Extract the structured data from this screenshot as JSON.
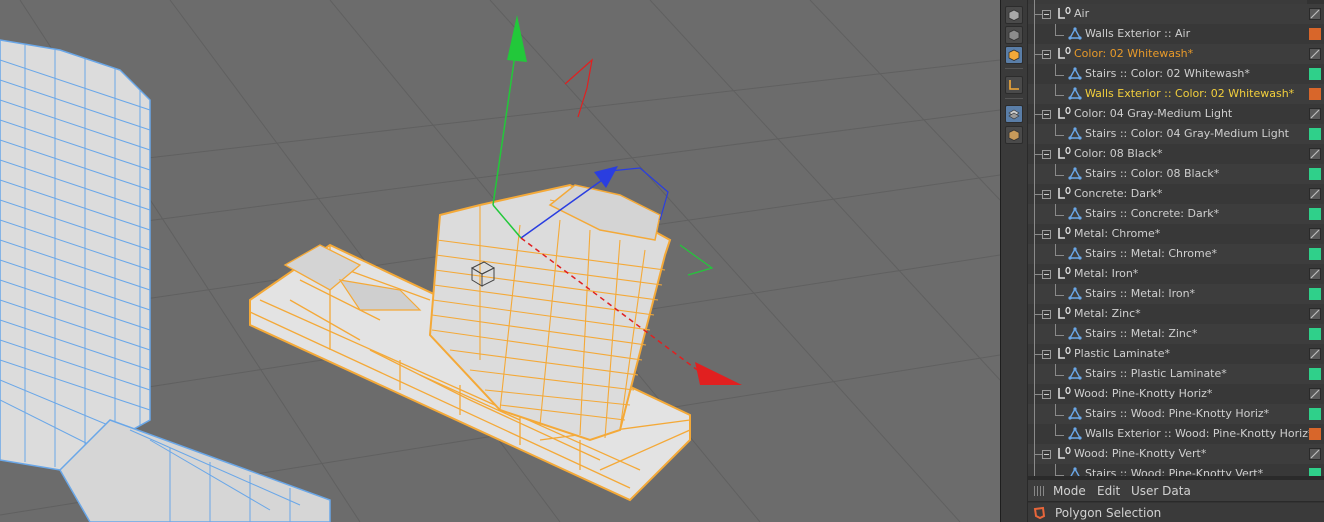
{
  "object_manager": {
    "rows": [
      {
        "label": "Air",
        "level": 0,
        "color": "normal",
        "tag": "slash"
      },
      {
        "label": "Walls Exterior :: Air",
        "level": 1,
        "color": "normal",
        "tag": "orange"
      },
      {
        "label": "Color: 02 Whitewash*",
        "level": 0,
        "color": "orange",
        "tag": "slash"
      },
      {
        "label": "Stairs :: Color: 02 Whitewash*",
        "level": 1,
        "color": "normal",
        "tag": "green"
      },
      {
        "label": "Walls Exterior :: Color: 02 Whitewash*",
        "level": 1,
        "color": "yellow",
        "tag": "orange"
      },
      {
        "label": "Color: 04 Gray-Medium Light",
        "level": 0,
        "color": "normal",
        "tag": "slash"
      },
      {
        "label": "Stairs :: Color: 04 Gray-Medium Light",
        "level": 1,
        "color": "normal",
        "tag": "green"
      },
      {
        "label": "Color: 08 Black*",
        "level": 0,
        "color": "normal",
        "tag": "slash"
      },
      {
        "label": "Stairs :: Color: 08 Black*",
        "level": 1,
        "color": "normal",
        "tag": "green"
      },
      {
        "label": "Concrete: Dark*",
        "level": 0,
        "color": "normal",
        "tag": "slash"
      },
      {
        "label": "Stairs :: Concrete: Dark*",
        "level": 1,
        "color": "normal",
        "tag": "green"
      },
      {
        "label": "Metal: Chrome*",
        "level": 0,
        "color": "normal",
        "tag": "slash"
      },
      {
        "label": "Stairs :: Metal: Chrome*",
        "level": 1,
        "color": "normal",
        "tag": "green"
      },
      {
        "label": "Metal: Iron*",
        "level": 0,
        "color": "normal",
        "tag": "slash"
      },
      {
        "label": "Stairs :: Metal: Iron*",
        "level": 1,
        "color": "normal",
        "tag": "green"
      },
      {
        "label": "Metal: Zinc*",
        "level": 0,
        "color": "normal",
        "tag": "slash"
      },
      {
        "label": "Stairs :: Metal: Zinc*",
        "level": 1,
        "color": "normal",
        "tag": "green"
      },
      {
        "label": "Plastic Laminate*",
        "level": 0,
        "color": "normal",
        "tag": "slash"
      },
      {
        "label": "Stairs :: Plastic Laminate*",
        "level": 1,
        "color": "normal",
        "tag": "green"
      },
      {
        "label": "Wood: Pine-Knotty Horiz*",
        "level": 0,
        "color": "normal",
        "tag": "slash"
      },
      {
        "label": "Stairs :: Wood: Pine-Knotty Horiz*",
        "level": 1,
        "color": "normal",
        "tag": "green"
      },
      {
        "label": "Walls Exterior :: Wood: Pine-Knotty Horiz*",
        "level": 1,
        "color": "normal",
        "tag": "orange"
      },
      {
        "label": "Wood: Pine-Knotty Vert*",
        "level": 0,
        "color": "normal",
        "tag": "slash"
      },
      {
        "label": "Stairs :: Wood: Pine-Knotty Vert*",
        "level": 1,
        "color": "normal",
        "tag": "green"
      }
    ]
  },
  "attributes": {
    "menu": {
      "mode": "Mode",
      "edit": "Edit",
      "user_data": "User Data"
    },
    "header": "Polygon Selection"
  },
  "colors": {
    "selection": "#f4a938",
    "wireframe": "#6aa7e8",
    "axis_x": "#e12020",
    "axis_y": "#22c83a",
    "axis_z": "#2a3ee0",
    "tag_green": "#2fd08a",
    "tag_orange": "#d8662a"
  },
  "toolbar_icons": [
    "cube-icon",
    "cube-gray-icon",
    "cube-active-icon",
    "floor-icon",
    "layers-icon",
    "texture-icon"
  ]
}
